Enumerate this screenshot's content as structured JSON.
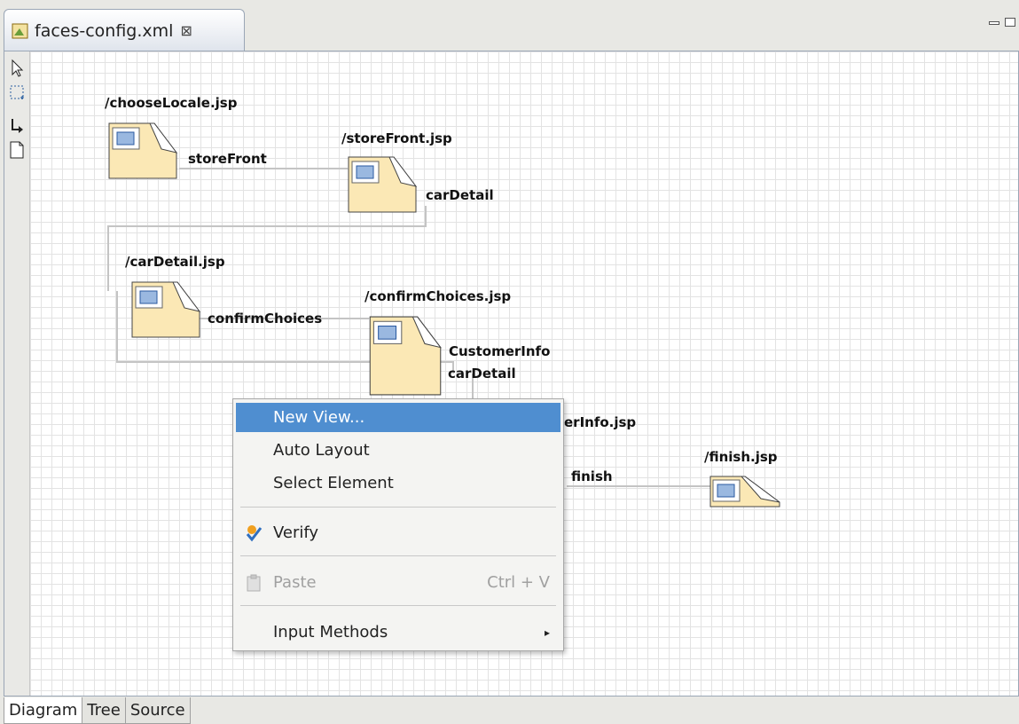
{
  "editor_tab": {
    "title": "faces-config.xml",
    "close_glyph": "⊠"
  },
  "nodes": [
    {
      "label": "/chooseLocale.jsp"
    },
    {
      "label": "/storeFront.jsp"
    },
    {
      "label": "/carDetail.jsp"
    },
    {
      "label": "/confirmChoices.jsp"
    },
    {
      "label": "erInfo.jsp"
    },
    {
      "label": "/finish.jsp"
    }
  ],
  "edges": [
    {
      "label": "storeFront"
    },
    {
      "label": "carDetail"
    },
    {
      "label": "confirmChoices"
    },
    {
      "label": "CustomerInfo"
    },
    {
      "label": "carDetail"
    },
    {
      "label": "finish"
    }
  ],
  "context_menu": {
    "new_view": "New View...",
    "auto_layout": "Auto Layout",
    "select_element": "Select Element",
    "verify": "Verify",
    "paste": "Paste",
    "paste_shortcut": "Ctrl + V",
    "input_methods": "Input Methods",
    "submenu_arrow": "▸"
  },
  "bottom_tabs": [
    {
      "label": "Diagram"
    },
    {
      "label": "Tree"
    },
    {
      "label": "Source"
    }
  ],
  "colors": {
    "node_fill": "#fbe8b5",
    "menu_highlight": "#4f8ed0",
    "tab_border": "#9aa6b6"
  },
  "icons": {
    "palette": [
      "select-arrow-icon",
      "marquee-icon",
      "connection-icon",
      "page-icon"
    ],
    "node": "jsp-page-icon",
    "verify": "verify-check-icon",
    "paste": "clipboard-icon"
  }
}
